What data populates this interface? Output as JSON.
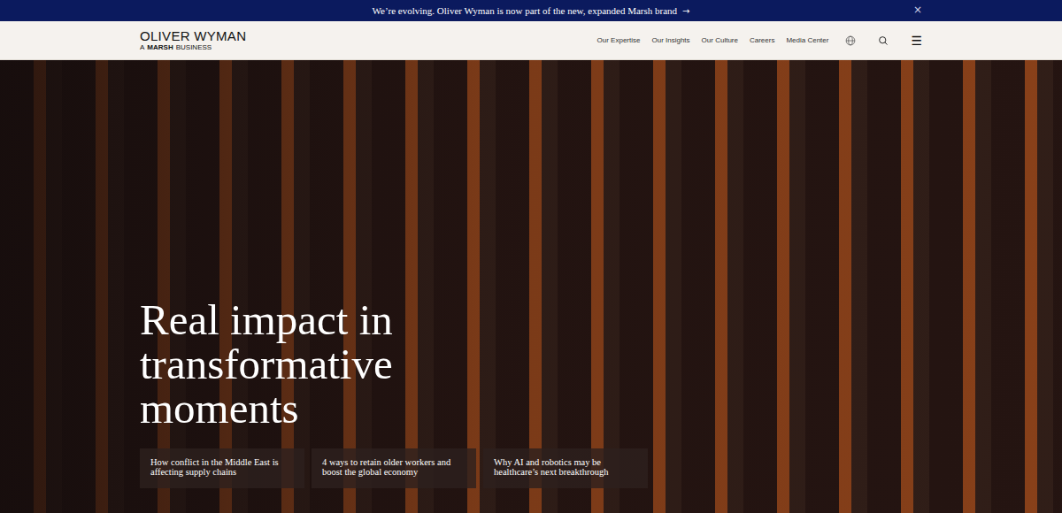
{
  "banner": {
    "text": "We’re evolving. Oliver Wyman is now part of the new, expanded Marsh brand",
    "arrow": "→",
    "close": "×"
  },
  "logo": {
    "name": "OLIVER WYMAN",
    "prefix": "A",
    "brand": "MARSH",
    "suffix": "BUSINESS"
  },
  "nav": {
    "items": [
      "Our Expertise",
      "Our Insights",
      "Our Culture",
      "Careers",
      "Media Center"
    ],
    "menu": "☰"
  },
  "hero": {
    "headline": [
      "Real impact in",
      "transformative",
      "moments"
    ],
    "cards": [
      {
        "title": "How conflict in the Middle East is affecting supply chains"
      },
      {
        "title": "4 ways to retain older workers and boost the global economy"
      },
      {
        "title": "Why AI and robotics may be healthcare’s next breakthrough"
      }
    ]
  }
}
